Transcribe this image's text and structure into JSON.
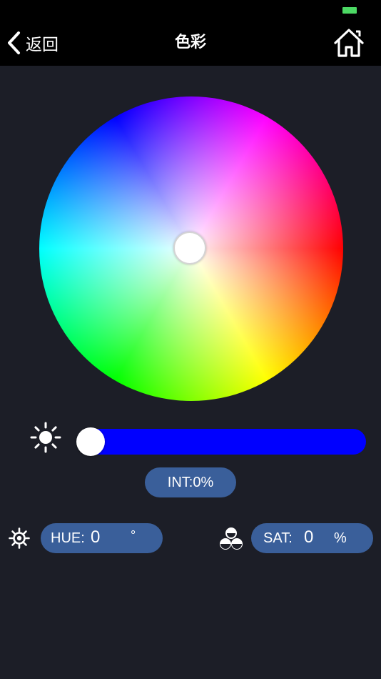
{
  "status_bar": {
    "battery_color": "#4cd964"
  },
  "nav": {
    "back_label": "返回",
    "back_icon": "chevron-left-icon",
    "title": "色彩",
    "home_icon": "home-icon"
  },
  "color_wheel": {
    "selected_color": "#ffffff"
  },
  "brightness": {
    "icon": "sun-icon",
    "level": 0,
    "track_color": "#0000ff",
    "readout": "INT:0%"
  },
  "hue": {
    "icon": "gear-sun-icon",
    "label": "HUE:",
    "value": "0",
    "unit": "°"
  },
  "saturation": {
    "icon": "three-circles-icon",
    "label": "SAT:",
    "value": "0",
    "unit": "%"
  },
  "colors": {
    "background": "#1c1e27",
    "topbar": "#000000",
    "pill": "#3a5f9a"
  }
}
